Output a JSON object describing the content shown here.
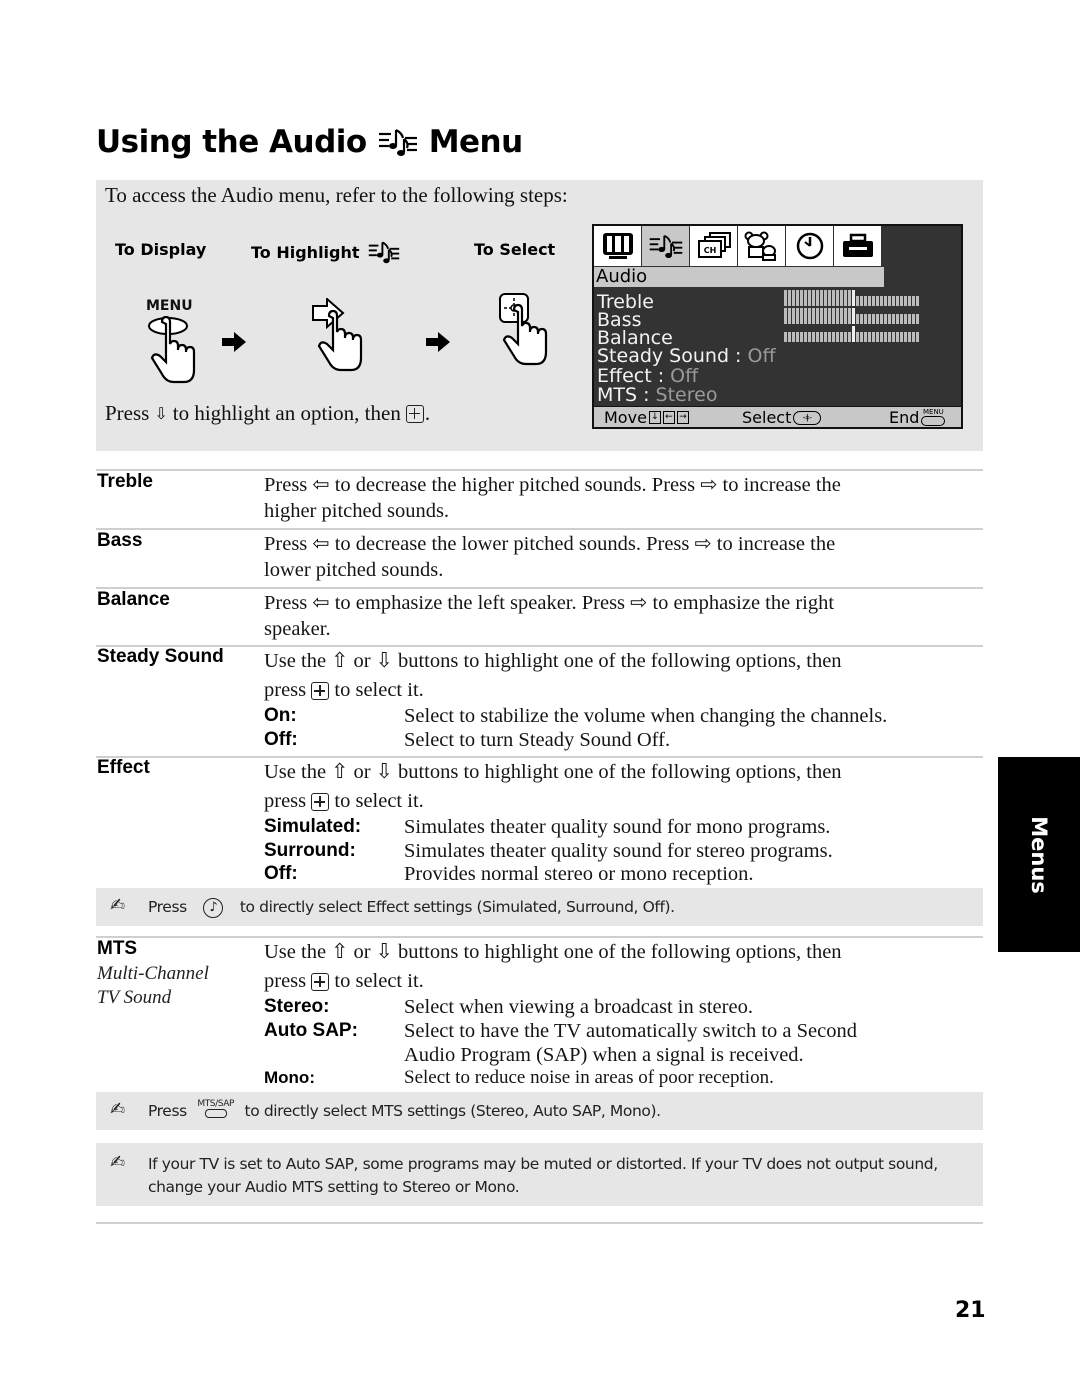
{
  "page": {
    "title_before_icon": "Using the Audio",
    "title_after_icon": "Menu",
    "title_icon": "audio-notes-icon",
    "page_number": "21",
    "side_tab": "Menus"
  },
  "steps_box": {
    "intro": "To access the Audio menu, refer to the following steps:",
    "steps": [
      {
        "label": "To Display",
        "key_label": "MENU",
        "icon": "hand-press-menu-icon"
      },
      {
        "label": "To Highlight",
        "icon": "hand-press-arrow-icon",
        "label_icon": "audio-notes-icon"
      },
      {
        "label": "To Select",
        "icon": "hand-press-select-icon"
      }
    ],
    "press_line": {
      "before": "Press",
      "arrow": "⇩",
      "middle": "to highlight an option, then",
      "after": "."
    }
  },
  "osd": {
    "tabs": [
      "video-icon",
      "audio-icon",
      "channel-icon",
      "parent-icon",
      "timer-icon",
      "setup-icon"
    ],
    "active_tab": "audio-icon",
    "header": "Audio",
    "rows": [
      {
        "label": "Treble",
        "value": "",
        "slider": 0.5
      },
      {
        "label": "Bass",
        "value": "",
        "slider": 0.5
      },
      {
        "label": "Balance",
        "value": "",
        "slider": 0.5
      },
      {
        "label": "Steady Sound : ",
        "value": "Off"
      },
      {
        "label": "Effect : ",
        "value": "Off"
      },
      {
        "label": "MTS : ",
        "value": "Stereo"
      }
    ],
    "footer": {
      "move": "Move",
      "move_keys": [
        "↓",
        "←",
        "→"
      ],
      "select": "Select",
      "end": "End",
      "end_key": "MENU"
    }
  },
  "items": [
    {
      "term": "Treble",
      "lines": [
        "Press ⇦ to decrease the higher pitched sounds. Press ⇨ to increase the",
        "higher pitched sounds."
      ]
    },
    {
      "term": "Bass",
      "lines": [
        "Press ⇦ to decrease the lower pitched sounds. Press ⇨ to increase the",
        "lower pitched sounds."
      ]
    },
    {
      "term": "Balance",
      "lines": [
        "Press ⇦ to emphasize the left speaker. Press ⇨ to emphasize the right",
        "speaker."
      ]
    },
    {
      "term": "Steady Sound",
      "intro": [
        "Use the ⇧ or ⇩ buttons to highlight one of the following options, then",
        "press",
        "to select it."
      ],
      "options": [
        {
          "key": "On:",
          "value": "Select to stabilize the volume when changing the channels."
        },
        {
          "key": "Off:",
          "value": "Select to turn Steady Sound Off."
        }
      ]
    },
    {
      "term": "Effect",
      "intro": [
        "Use the ⇧ or ⇩ buttons to highlight one of the following options, then",
        "press",
        "to select it."
      ],
      "options": [
        {
          "key": "Simulated:",
          "value": "Simulates theater quality sound for mono programs."
        },
        {
          "key": "Surround:",
          "value": "Simulates theater quality sound for stereo programs."
        },
        {
          "key": "Off:",
          "value": "Provides normal stereo or mono reception."
        }
      ]
    },
    {
      "term": "MTS",
      "subterm": [
        "Multi-Channel",
        "TV Sound"
      ],
      "intro": [
        "Use the ⇧ or ⇩ buttons to highlight one of the following options, then",
        "press",
        "to select it."
      ],
      "options": [
        {
          "key": "Stereo:",
          "value": "Select when viewing a broadcast in stereo."
        },
        {
          "key": "Auto SAP:",
          "value": "Select to have the TV automatically switch to a Second"
        },
        {
          "key": "",
          "value": "Audio Program (SAP) when a signal is received."
        },
        {
          "key": "Mono:",
          "value": "Select to reduce noise in areas of poor reception."
        }
      ]
    }
  ],
  "notes": [
    {
      "before": "Press",
      "button": "note-button-icon",
      "after": "to directly select Effect settings (Simulated, Surround, Off)."
    },
    {
      "before": "Press",
      "button_label": "MTS/SAP",
      "after": "to directly select MTS settings (Stereo, Auto SAP, Mono)."
    },
    {
      "text": [
        "If your TV is set to Auto SAP, some programs may be muted or distorted. If your TV does not output sound,",
        "change your Audio MTS setting to Stereo or Mono."
      ]
    }
  ]
}
